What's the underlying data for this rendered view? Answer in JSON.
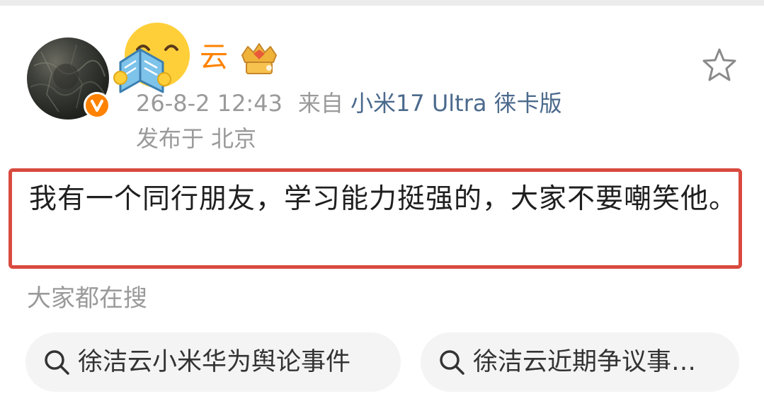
{
  "post": {
    "author": {
      "name_visible": "云",
      "avatar_icon": "avatar-image",
      "verified_icon": "verified-v-icon",
      "badge_icon": "crown-badge-icon",
      "sticker_icon": "reading-emoji-sticker"
    },
    "timestamp": "26-8-2 12:43",
    "source_label": "来自",
    "device": "小米17 Ultra 徕卡版",
    "location_label": "发布于",
    "location": "北京",
    "content": "我有一个同行朋友，学习能力挺强的，大家不要嘲笑他。",
    "favorite_icon": "star-icon"
  },
  "search": {
    "heading": "大家都在搜",
    "chips": [
      {
        "label": "徐洁云小米华为舆论事件",
        "icon": "search-icon"
      },
      {
        "label": "徐洁云近期争议事…",
        "icon": "search-icon"
      }
    ]
  },
  "colors": {
    "accent_orange": "#ff8200",
    "highlight_border": "#d94a3f",
    "device_link": "#4b6a8c",
    "muted_text": "#9a9a9a"
  }
}
